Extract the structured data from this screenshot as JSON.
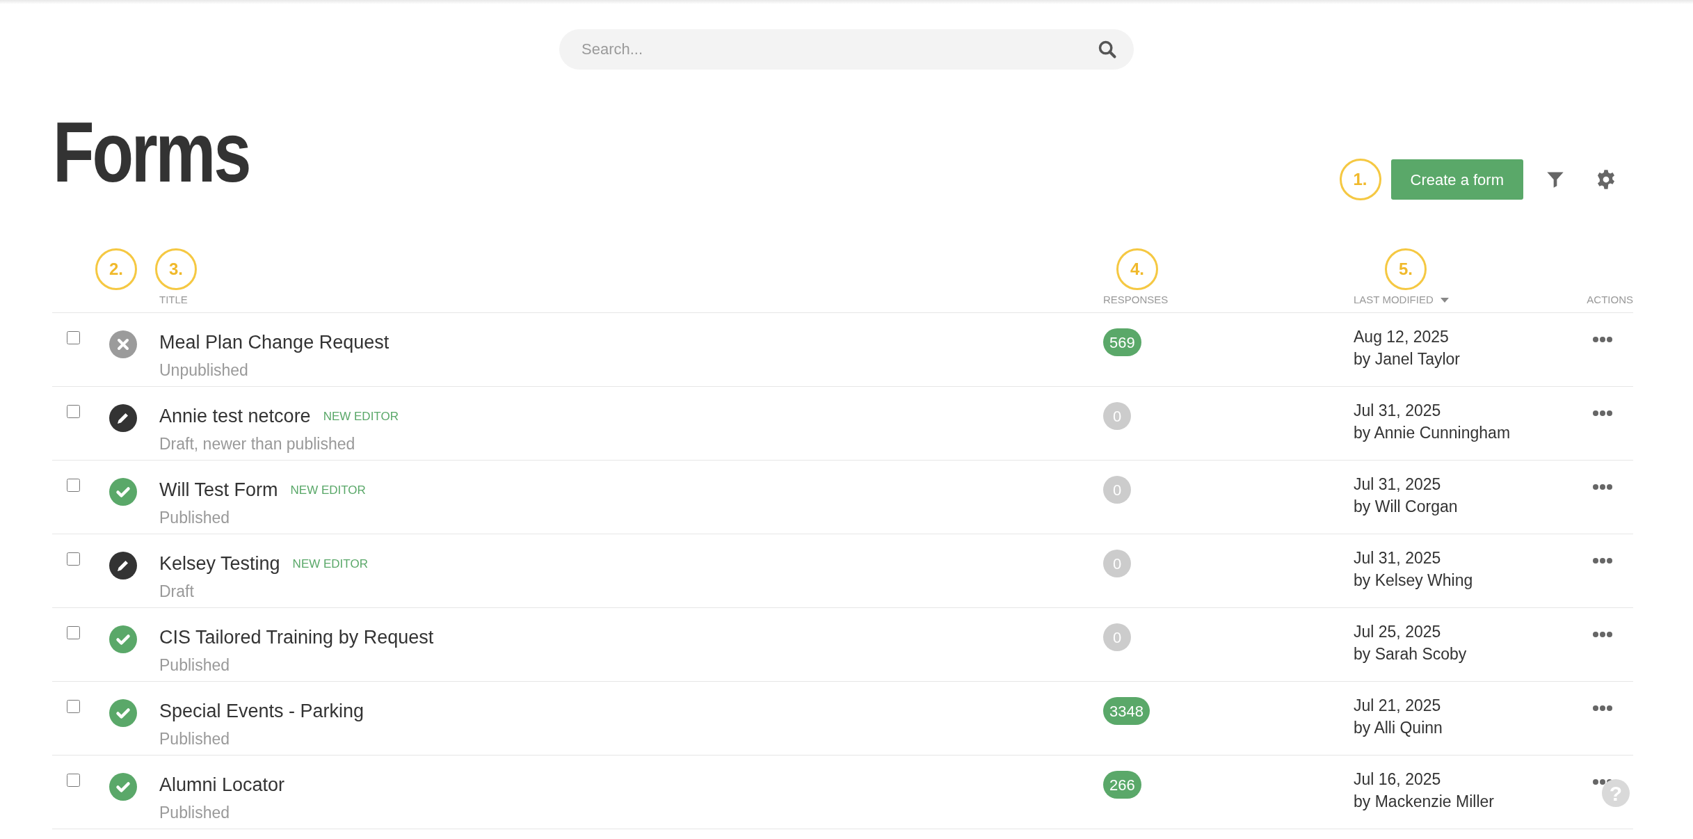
{
  "search": {
    "placeholder": "Search..."
  },
  "page_title": "Forms",
  "toolbar": {
    "callout": "1.",
    "create_button": "Create a form"
  },
  "table": {
    "columns": [
      {
        "callout": "2."
      },
      {
        "label": "TITLE",
        "callout": "3."
      },
      {
        "label": "RESPONSES",
        "callout": "4."
      },
      {
        "label": "LAST MODIFIED",
        "callout": "5.",
        "sorted": true
      },
      {
        "label": "ACTIONS"
      }
    ],
    "rows": [
      {
        "checked": false,
        "kind": "unpublished",
        "title": "Meal Plan Change Request",
        "state": "Unpublished",
        "responses": {
          "count": "569",
          "color": "#5aa869"
        },
        "date": "Aug 12, 2025",
        "author": "by Janel Taylor"
      },
      {
        "checked": false,
        "kind": "draft",
        "title": "Annie test netcore",
        "tag": "NEW EDITOR",
        "state": "Draft, newer than published",
        "responses": {
          "count": "0",
          "color": "#cccccc"
        },
        "date": "Jul 31, 2025",
        "author": "by Annie Cunningham"
      },
      {
        "checked": false,
        "kind": "published",
        "title": "Will Test Form",
        "tag": "NEW EDITOR",
        "state": "Published",
        "responses": {
          "count": "0",
          "color": "#cccccc"
        },
        "date": "Jul 31, 2025",
        "author": "by Will Corgan"
      },
      {
        "checked": false,
        "kind": "draft",
        "title": "Kelsey Testing",
        "tag": "NEW EDITOR",
        "state": "Draft",
        "responses": {
          "count": "0",
          "color": "#cccccc"
        },
        "date": "Jul 31, 2025",
        "author": "by Kelsey Whing"
      },
      {
        "checked": false,
        "kind": "published",
        "title": "CIS Tailored Training by Request",
        "state": "Published",
        "responses": {
          "count": "0",
          "color": "#cccccc"
        },
        "date": "Jul 25, 2025",
        "author": "by Sarah Scoby"
      },
      {
        "checked": false,
        "kind": "published",
        "title": "Special Events - Parking",
        "state": "Published",
        "responses": {
          "count": "3348",
          "color": "#5aa869"
        },
        "date": "Jul 21, 2025",
        "author": "by Alli Quinn"
      },
      {
        "checked": false,
        "kind": "published",
        "title": "Alumni Locator",
        "state": "Published",
        "responses": {
          "count": "266",
          "color": "#5aa869"
        },
        "date": "Jul 16, 2025",
        "author": "by Mackenzie Miller"
      }
    ]
  },
  "help_button": "?"
}
